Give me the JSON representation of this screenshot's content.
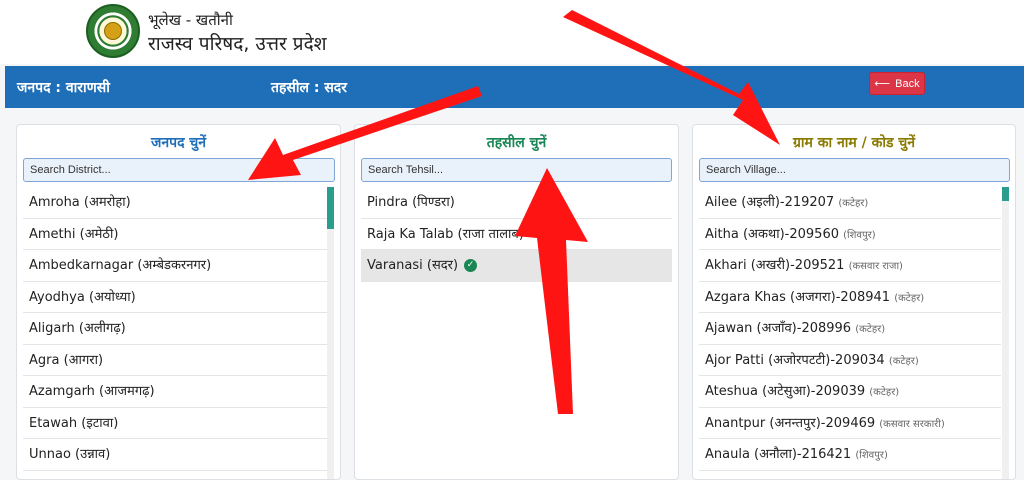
{
  "header": {
    "line1": "भूलेख - खतौनी",
    "line2": "राजस्व परिषद, उत्तर प्रदेश"
  },
  "info_bar": {
    "district": "जनपद : वाराणसी",
    "tehsil": "तहसील : सदर",
    "back_label": "Back"
  },
  "colors": {
    "bar": "#1f6fb8",
    "district_title": "#1f6fb8",
    "tehsil_title": "#198754",
    "village_title": "#8a7a00",
    "back": "#dc3545",
    "arrow": "#ff0000"
  },
  "district_panel": {
    "title": "जनपद चुनें",
    "search_placeholder": "Search District...",
    "items": [
      {
        "label": "Amroha (अमरोहा)"
      },
      {
        "label": "Amethi (अमेठी)"
      },
      {
        "label": "Ambedkarnagar (अम्बेडकरनगर)"
      },
      {
        "label": "Ayodhya (अयोध्या)"
      },
      {
        "label": "Aligarh (अलीगढ़)"
      },
      {
        "label": "Agra (आगरा)"
      },
      {
        "label": "Azamgarh (आजमगढ़)"
      },
      {
        "label": "Etawah (इटावा)"
      },
      {
        "label": "Unnao (उन्नाव)"
      }
    ]
  },
  "tehsil_panel": {
    "title": "तहसील चुनें",
    "search_placeholder": "Search Tehsil...",
    "items": [
      {
        "label": "Pindra (पिण्डरा)"
      },
      {
        "label": "Raja Ka Talab (राजा तालाब)"
      },
      {
        "label": "Varanasi (सदर)",
        "selected": true
      }
    ]
  },
  "village_panel": {
    "title": "ग्राम का नाम / कोड चुनें",
    "search_placeholder": "Search Village...",
    "items": [
      {
        "label": "Ailee (अइली)-219207",
        "sub": "(कटेहर)"
      },
      {
        "label": "Aitha (अकथा)-209560",
        "sub": "(शिवपुर)"
      },
      {
        "label": "Akhari (अखरी)-209521",
        "sub": "(कसवार राजा)"
      },
      {
        "label": "Azgara Khas (अजगरा)-208941",
        "sub": "(कटेहर)"
      },
      {
        "label": "Ajawan (अजाँव)-208996",
        "sub": "(कटेहर)"
      },
      {
        "label": "Ajor Patti (अजोरपटटी)-209034",
        "sub": "(कटेहर)"
      },
      {
        "label": "Ateshua (अटेसुआ)-209039",
        "sub": "(कटेहर)"
      },
      {
        "label": "Anantpur (अनन्तपुर)-209469",
        "sub": "(कसवार सरकारी)"
      },
      {
        "label": "Anaula (अनौला)-216421",
        "sub": "(शिवपुर)"
      }
    ]
  },
  "icons": {
    "back": "left-arrow-icon",
    "selected": "check-circle-icon",
    "annotation": "red-arrow-icon"
  }
}
